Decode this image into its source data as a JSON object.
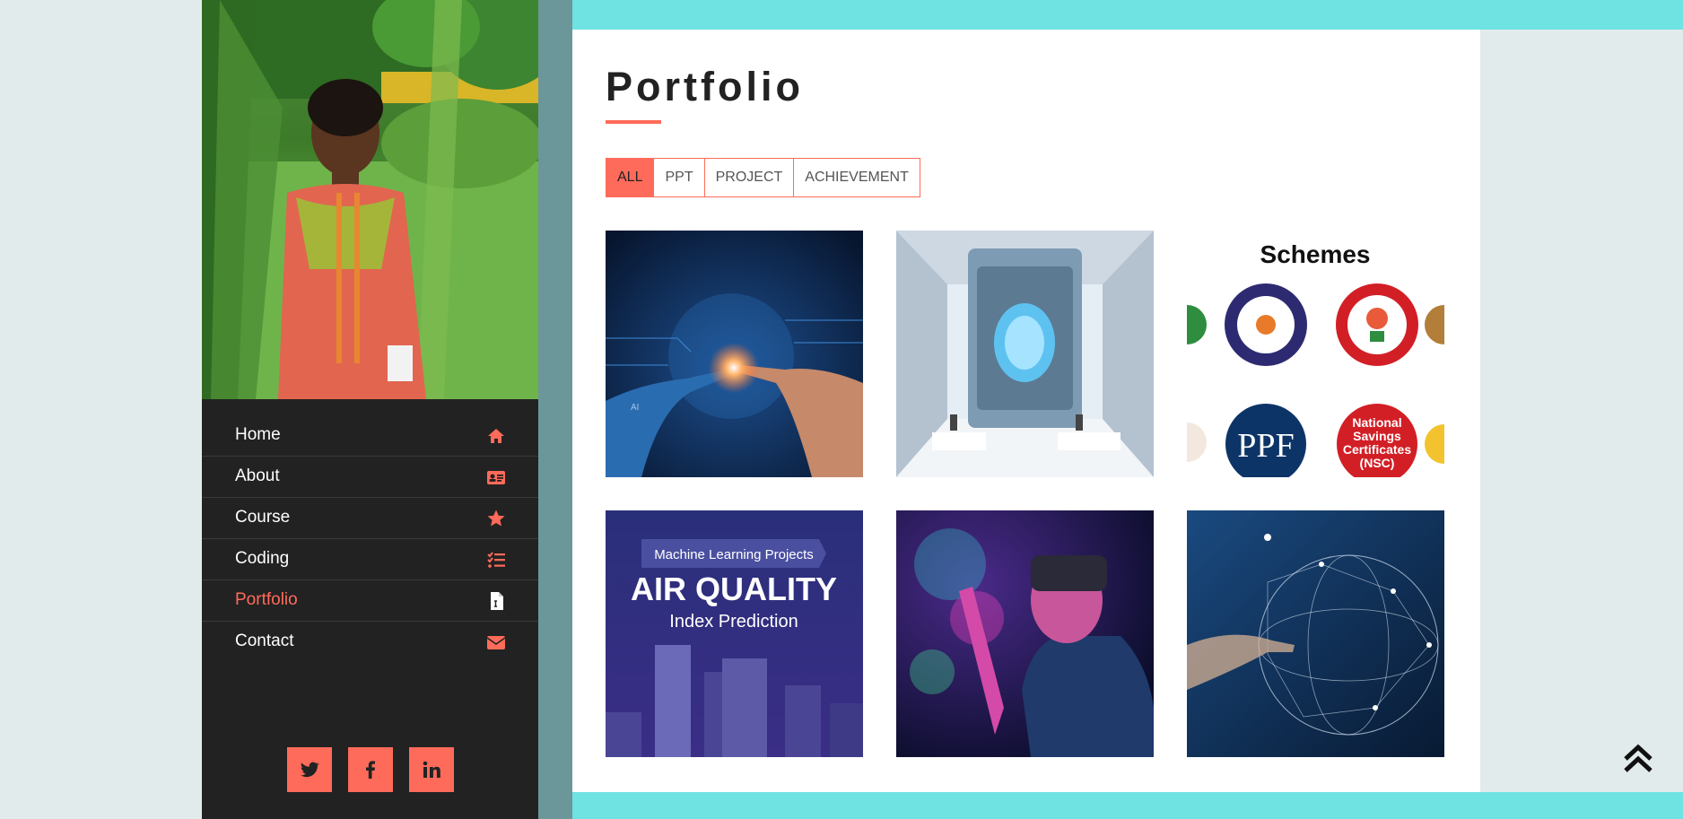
{
  "sidebar": {
    "nav": [
      {
        "label": "Home",
        "icon": "home-icon",
        "active": false
      },
      {
        "label": "About",
        "icon": "id-card-icon",
        "active": false
      },
      {
        "label": "Course",
        "icon": "star-icon",
        "active": false
      },
      {
        "label": "Coding",
        "icon": "tasks-icon",
        "active": false
      },
      {
        "label": "Portfolio",
        "icon": "file-icon",
        "active": true
      },
      {
        "label": "Contact",
        "icon": "envelope-icon",
        "active": false
      }
    ],
    "social": [
      "twitter-icon",
      "facebook-icon",
      "linkedin-icon"
    ]
  },
  "main": {
    "title": "Portfolio",
    "filters": [
      {
        "label": "ALL",
        "active": true
      },
      {
        "label": "PPT",
        "active": false
      },
      {
        "label": "PROJECT",
        "active": false
      },
      {
        "label": "ACHIEVEMENT",
        "active": false
      }
    ],
    "tiles": {
      "schemes_heading": "Schemes",
      "schemes_ppf": "PPF",
      "schemes_nsc": "National Savings Certificates (NSC)",
      "ml_badge": "Machine Learning Projects",
      "air_quality_title": "AIR QUALITY",
      "air_quality_subtitle": "Index Prediction",
      "ai_label": "AI"
    }
  },
  "colors": {
    "accent": "#ff6b5a",
    "sidebar": "#222222",
    "band": "#6fe2e2",
    "strip": "#6b979b",
    "page": "#e2ebeb"
  }
}
